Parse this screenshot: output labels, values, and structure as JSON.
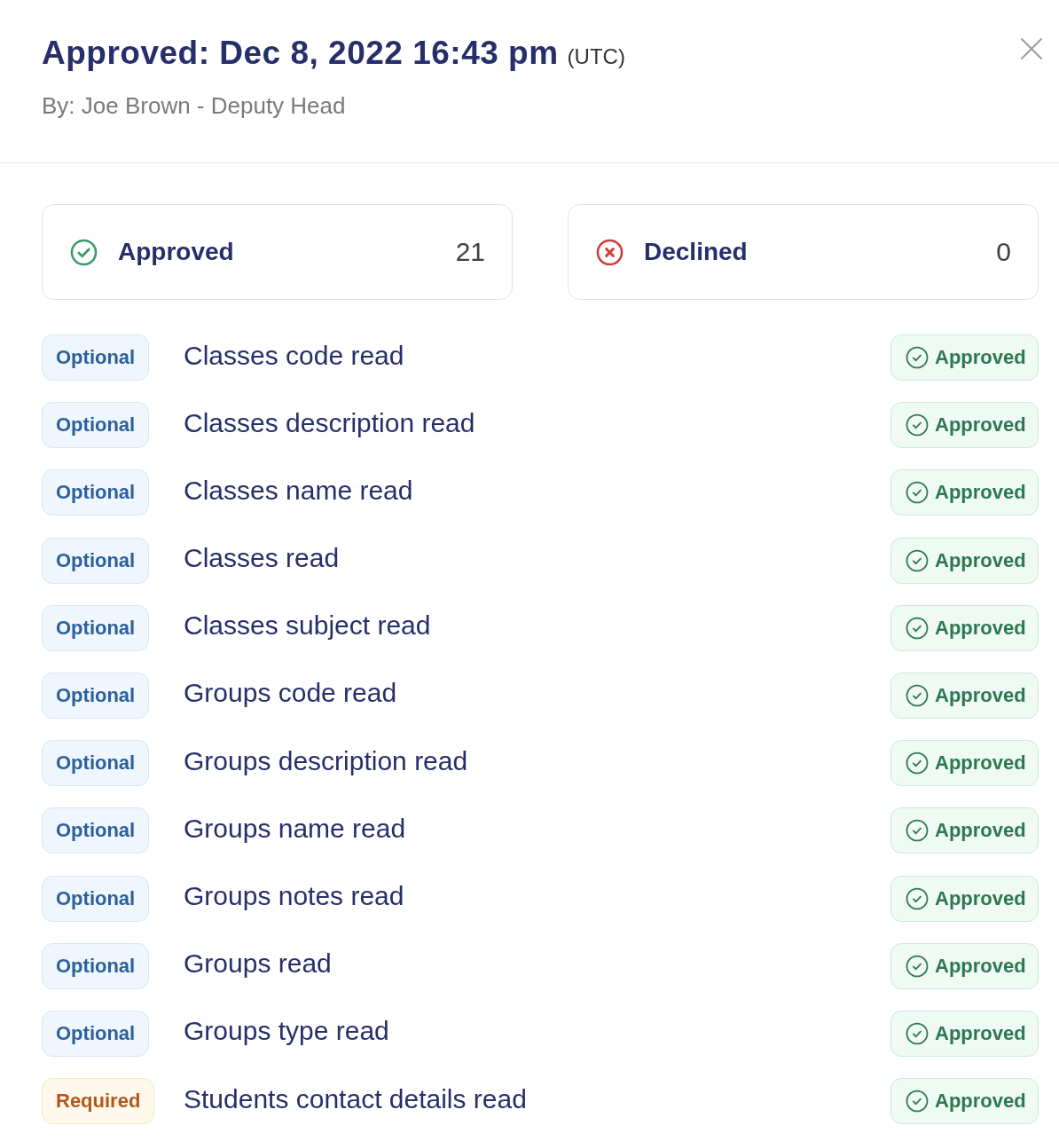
{
  "dialog": {
    "title": "Approved: Dec 8, 2022 16:43 pm",
    "title_suffix": "(UTC)",
    "subtitle": "By: Joe Brown - Deputy Head"
  },
  "summary": [
    {
      "kind": "approved",
      "label": "Approved",
      "count": "21"
    },
    {
      "kind": "declined",
      "label": "Declined",
      "count": "0"
    }
  ],
  "permissions": [
    {
      "kind": "optional",
      "tag": "Optional",
      "name": "Classes code read",
      "status": {
        "kind": "approved",
        "label": "Approved"
      }
    },
    {
      "kind": "optional",
      "tag": "Optional",
      "name": "Classes description read",
      "status": {
        "kind": "approved",
        "label": "Approved"
      }
    },
    {
      "kind": "optional",
      "tag": "Optional",
      "name": "Classes name read",
      "status": {
        "kind": "approved",
        "label": "Approved"
      }
    },
    {
      "kind": "optional",
      "tag": "Optional",
      "name": "Classes read",
      "status": {
        "kind": "approved",
        "label": "Approved"
      }
    },
    {
      "kind": "optional",
      "tag": "Optional",
      "name": "Classes subject read",
      "status": {
        "kind": "approved",
        "label": "Approved"
      }
    },
    {
      "kind": "optional",
      "tag": "Optional",
      "name": "Groups code read",
      "status": {
        "kind": "approved",
        "label": "Approved"
      }
    },
    {
      "kind": "optional",
      "tag": "Optional",
      "name": "Groups description read",
      "status": {
        "kind": "approved",
        "label": "Approved"
      }
    },
    {
      "kind": "optional",
      "tag": "Optional",
      "name": "Groups name read",
      "status": {
        "kind": "approved",
        "label": "Approved"
      }
    },
    {
      "kind": "optional",
      "tag": "Optional",
      "name": "Groups notes read",
      "status": {
        "kind": "approved",
        "label": "Approved"
      }
    },
    {
      "kind": "optional",
      "tag": "Optional",
      "name": "Groups read",
      "status": {
        "kind": "approved",
        "label": "Approved"
      }
    },
    {
      "kind": "optional",
      "tag": "Optional",
      "name": "Groups type read",
      "status": {
        "kind": "approved",
        "label": "Approved"
      }
    },
    {
      "kind": "required",
      "tag": "Required",
      "name": "Students contact details read",
      "status": {
        "kind": "approved",
        "label": "Approved"
      }
    }
  ]
}
